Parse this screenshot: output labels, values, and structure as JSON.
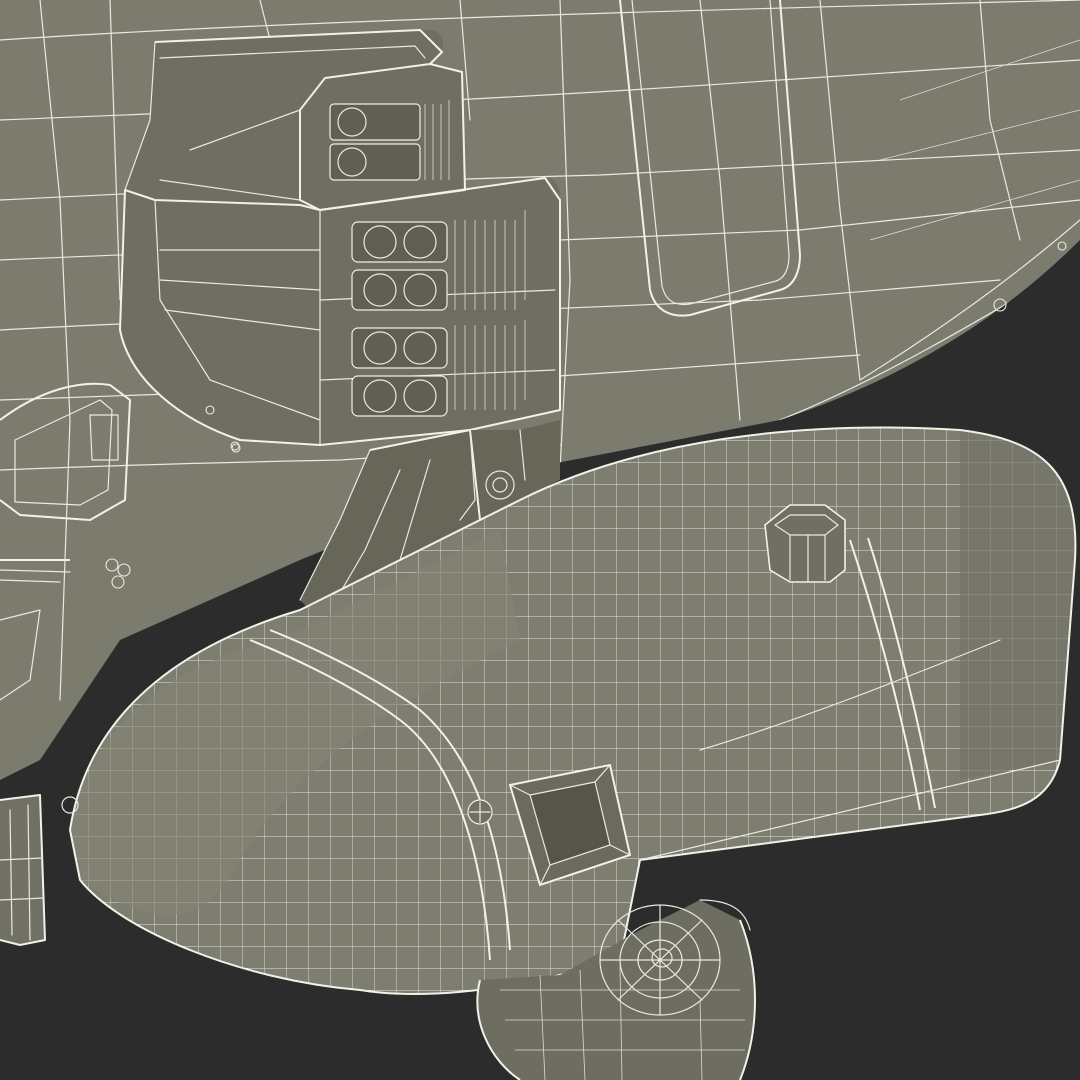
{
  "colors": {
    "background": "#2c2c2c",
    "surface": "#7b7b6e",
    "surface_dark": "#6a6a5e",
    "surface_light": "#858577",
    "wire": "#e9e9df"
  },
  "scene": {
    "subject": "helicopter-nose-wireframe",
    "render_style": "wireframe-on-shaded"
  }
}
